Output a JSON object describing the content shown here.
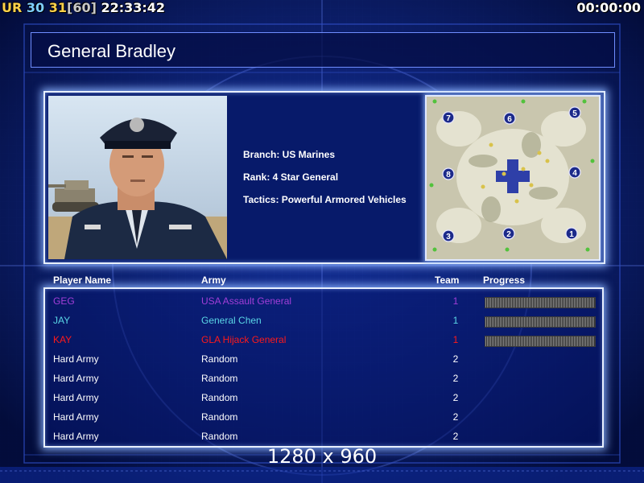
{
  "hud": {
    "ur": "UR",
    "val_a": "30",
    "val_b": "31",
    "val_bracket": "[60]",
    "clock": "22:33:42",
    "timer": "00:00:00"
  },
  "general": {
    "title": "General Bradley",
    "branch": "Branch: US Marines",
    "rank": "Rank: 4 Star General",
    "tactics": "Tactics: Powerful Armored Vehicles"
  },
  "minimap": {
    "slots": [
      "1",
      "2",
      "3",
      "4",
      "5",
      "6",
      "7",
      "8"
    ]
  },
  "table": {
    "headers": {
      "player_name": "Player Name",
      "army": "Army",
      "team": "Team",
      "progress": "Progress"
    },
    "rows": [
      {
        "name": "GEG",
        "army": "USA Assault General",
        "team": "1",
        "progress": 1.0,
        "color": "#a23ed8"
      },
      {
        "name": "JAY",
        "army": "General Chen",
        "team": "1",
        "progress": 1.0,
        "color": "#5ad6e6"
      },
      {
        "name": "KAY",
        "army": "GLA Hijack General",
        "team": "1",
        "progress": 1.0,
        "color": "#ff1a1a"
      },
      {
        "name": "Hard Army",
        "army": "Random",
        "team": "2",
        "progress": null,
        "color": "#ffffff"
      },
      {
        "name": "Hard Army",
        "army": "Random",
        "team": "2",
        "progress": null,
        "color": "#ffffff"
      },
      {
        "name": "Hard Army",
        "army": "Random",
        "team": "2",
        "progress": null,
        "color": "#ffffff"
      },
      {
        "name": "Hard Army",
        "army": "Random",
        "team": "2",
        "progress": null,
        "color": "#ffffff"
      },
      {
        "name": "Hard Army",
        "army": "Random",
        "team": "2",
        "progress": null,
        "color": "#ffffff"
      }
    ]
  },
  "resolution": "1280 x 960",
  "colors": {
    "background": "#06124a",
    "panel_border": "#e8f0ff",
    "glow": "#8cb4ff"
  }
}
